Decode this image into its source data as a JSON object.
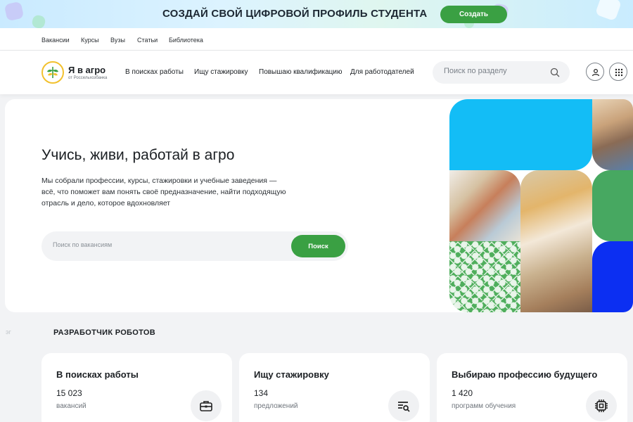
{
  "promo": {
    "text": "СОЗДАЙ СВОЙ ЦИФРОВОЙ ПРОФИЛЬ СТУДЕНТА",
    "button": "Создать"
  },
  "topnav": [
    "Вакансии",
    "Курсы",
    "Вузы",
    "Статьи",
    "Библиотека"
  ],
  "logo": {
    "title": "Я в агро",
    "subtitle": "от Россельхозбанка"
  },
  "mainnav": [
    "В поисках работы",
    "Ищу стажировку",
    "Повышаю квалификацию",
    "Для работодателей"
  ],
  "header_search": {
    "placeholder": "Поиск по разделу"
  },
  "hero": {
    "title": "Учись, живи, работай в агро",
    "description": "Мы собрали профессии, курсы, стажировки и учебные заведения — всё, что поможет вам понять своё предназначение, найти подходящую отрасль и дело, которое вдохновляет",
    "search_placeholder": "Поиск по вакансиям",
    "search_button": "Поиск"
  },
  "section": {
    "label": "РАЗРАБОТЧИК РОБОТОВ",
    "side_glyph": "эг"
  },
  "cards": [
    {
      "title": "В поисках работы",
      "count": "15 023",
      "unit": "вакансий",
      "icon": "briefcase-icon"
    },
    {
      "title": "Ищу стажировку",
      "count": "134",
      "unit": "предложений",
      "icon": "search-list-icon"
    },
    {
      "title": "Выбираю профессию будущего",
      "count": "1 420",
      "unit": "программ обучения",
      "icon": "chip-icon"
    }
  ],
  "colors": {
    "accent_green": "#3aa043",
    "tile_blue": "#13bdf6",
    "tile_green": "#47a861",
    "tile_navy": "#0c2ff2",
    "logo_yellow": "#f2c12e"
  }
}
